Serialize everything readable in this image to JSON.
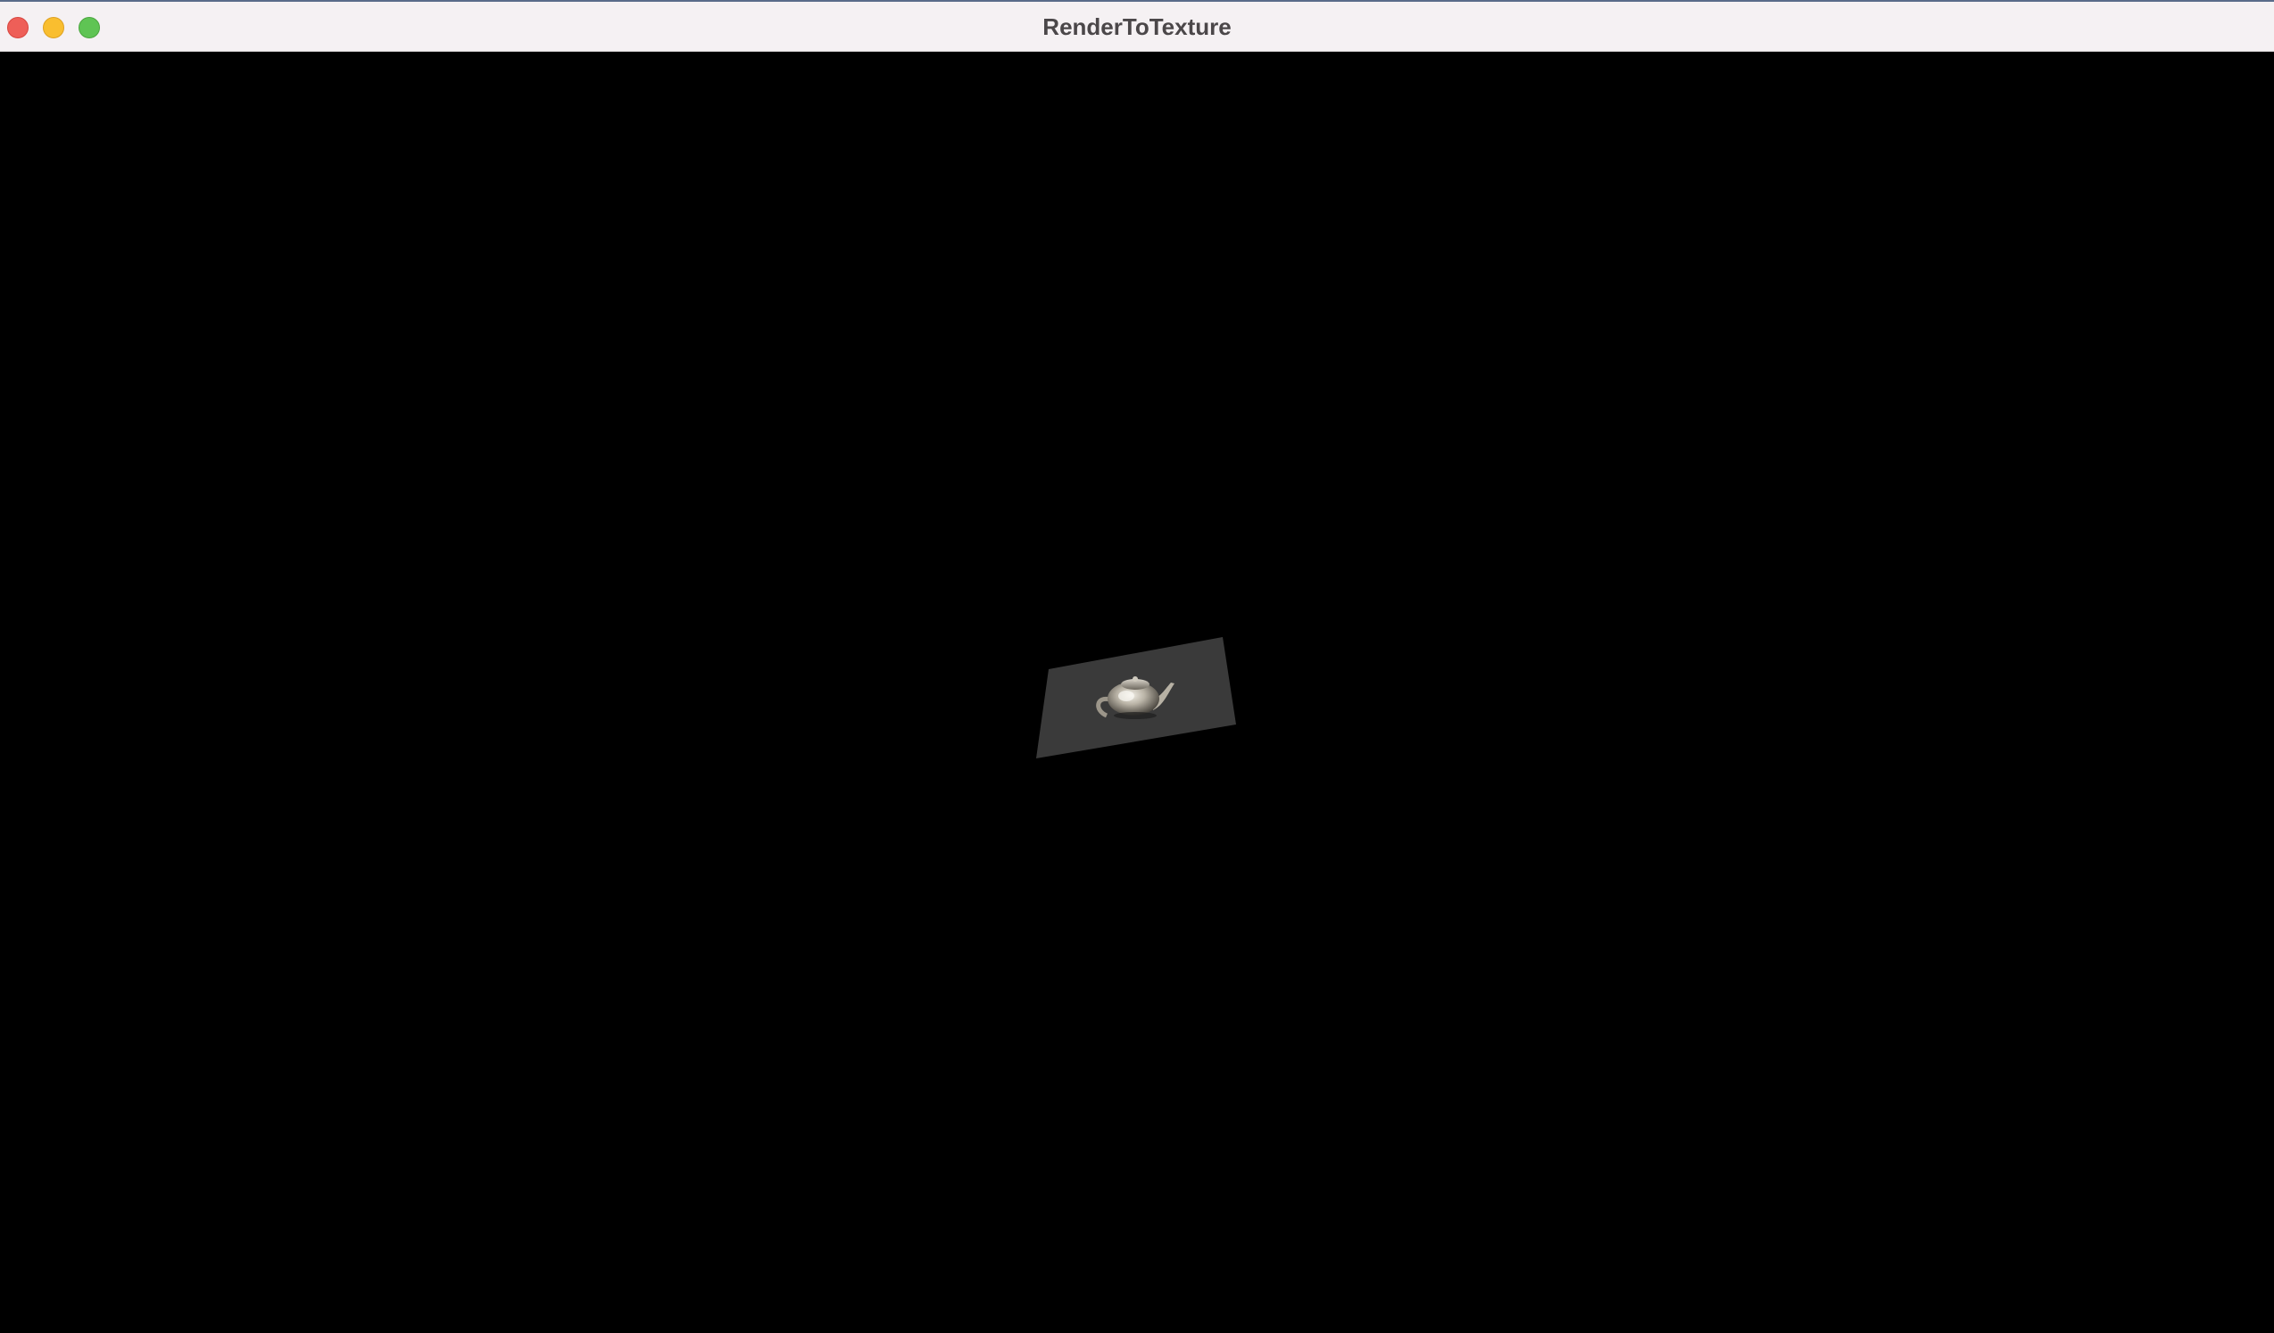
{
  "window": {
    "title": "RenderToTexture",
    "controls": {
      "close": "close-icon",
      "minimize": "minimize-icon",
      "maximize": "maximize-icon"
    }
  },
  "scene": {
    "background_color": "#000000",
    "plane_color": "#3a3a3a",
    "object": "teapot"
  },
  "colors": {
    "titlebar_bg": "#f5f1f3",
    "title_text": "#4b4749",
    "close": "#ee5f58",
    "minimize": "#f9be2f",
    "maximize": "#5fc454"
  }
}
